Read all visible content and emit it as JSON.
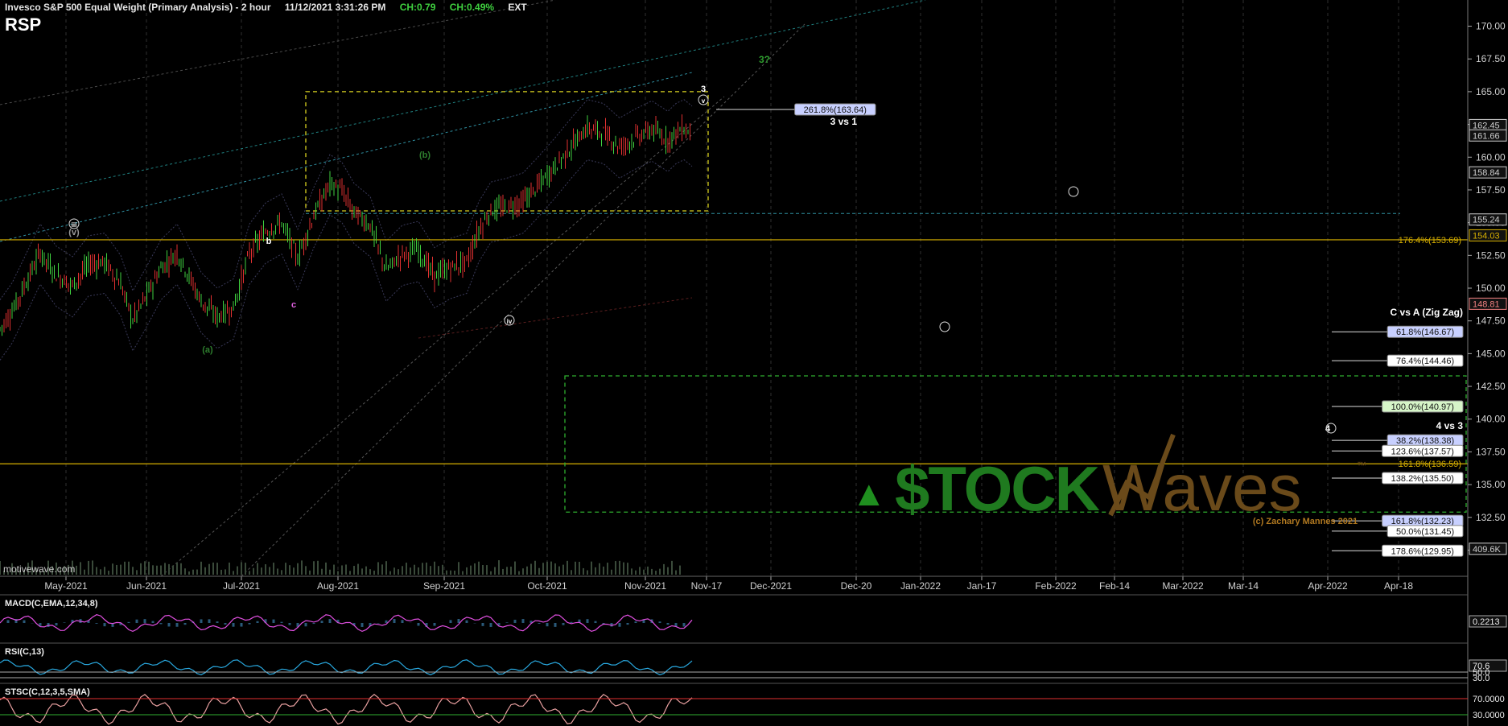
{
  "header": {
    "title": "Invesco S&P 500 Equal Weight (Primary Analysis) - 2 hour",
    "timestamp": "11/12/2021 3:31:26 PM",
    "change": "CH:0.79",
    "change_pct": "CH:0.49%",
    "session": "EXT",
    "symbol": "RSP",
    "brand": "motivewave.com"
  },
  "colors": {
    "bg": "#000000",
    "up": "#3fd13f",
    "down": "#e03030",
    "fib": "#d8b000",
    "axis": "#cfcfcf",
    "macd": "#e04fe0",
    "rsi": "#29a9e0",
    "stoch": "#e8a0a0"
  },
  "chart_data": {
    "type": "line",
    "title": "Invesco S&P 500 Equal Weight (Primary Analysis) - 2 hour",
    "ylim": [
      128.0,
      172.0
    ],
    "y_ticks": [
      "170.00",
      "167.50",
      "165.00",
      "162.50",
      "160.00",
      "157.50",
      "155.00",
      "152.50",
      "150.00",
      "147.50",
      "145.00",
      "142.50",
      "140.00",
      "137.50",
      "135.00",
      "132.50",
      "130.00"
    ],
    "x_ticks": [
      "May-2021",
      "Jun-2021",
      "Jul-2021",
      "Aug-2021",
      "Sep-2021",
      "Oct-2021",
      "Nov-2021",
      "Nov-17",
      "Dec-2021",
      "Dec-20",
      "Jan-2022",
      "Jan-17",
      "Feb-2022",
      "Feb-14",
      "Mar-2022",
      "Mar-14",
      "Apr-2022",
      "Apr-18"
    ],
    "series": [
      {
        "x": [
          0,
          3,
          6,
          10,
          14,
          18,
          22,
          26,
          30,
          33,
          36,
          40,
          44,
          47,
          50,
          54,
          58,
          62,
          66,
          70,
          74,
          78,
          82,
          85,
          88,
          92,
          96,
          100,
          104,
          108,
          112,
          116,
          119,
          122,
          126,
          130,
          134,
          138,
          142,
          146,
          150,
          154,
          158,
          162,
          164,
          166,
          168,
          170,
          172
        ],
        "y": [
          146.9,
          148.2,
          150.1,
          152.7,
          151.0,
          150.2,
          151.8,
          152.0,
          150.3,
          147.6,
          149.2,
          151.5,
          152.7,
          150.9,
          149.0,
          147.8,
          148.5,
          152.7,
          154.3,
          155.0,
          152.3,
          155.5,
          158.0,
          157.4,
          155.8,
          154.8,
          151.4,
          152.6,
          152.9,
          150.9,
          151.6,
          152.0,
          154.4,
          155.9,
          156.2,
          156.6,
          157.9,
          159.3,
          160.8,
          162.2,
          161.9,
          160.8,
          161.5,
          162.1,
          161.7,
          161.3,
          161.9,
          162.2,
          161.7
        ]
      }
    ],
    "price_labels": [
      {
        "value": 162.45,
        "text": "162.45",
        "color": "#cfcfcf"
      },
      {
        "value": 161.66,
        "text": "161.66",
        "color": "#cfcfcf"
      },
      {
        "value": 158.84,
        "text": "158.84",
        "color": "#cfcfcf"
      },
      {
        "value": 155.24,
        "text": "155.24",
        "color": "#cfcfcf"
      },
      {
        "value": 154.03,
        "text": "154.03",
        "color": "#d8b000"
      },
      {
        "value": 148.81,
        "text": "148.81",
        "color": "#f08080"
      },
      {
        "value": 130.1,
        "text": "409.6K",
        "color": "#cfcfcf"
      }
    ],
    "fib_lines": [
      {
        "value": 153.69,
        "label": "176.4%(153.69)"
      },
      {
        "value": 136.59,
        "label": "161.8%(136.59)"
      }
    ],
    "fib_boxes": [
      {
        "value": 163.64,
        "label": "261.8%(163.64)",
        "fill": "#c8d0ff"
      },
      {
        "value": 146.67,
        "label": "61.8%(146.67)",
        "fill": "#c8d0ff"
      },
      {
        "value": 144.46,
        "label": "76.4%(144.46)",
        "fill": "#ffffff"
      },
      {
        "value": 140.97,
        "label": "100.0%(140.97)",
        "fill": "#d6f5c8"
      },
      {
        "value": 138.38,
        "label": "38.2%(138.38)",
        "fill": "#c8d0ff"
      },
      {
        "value": 137.57,
        "label": "123.6%(137.57)",
        "fill": "#ffffff"
      },
      {
        "value": 135.5,
        "label": "138.2%(135.50)",
        "fill": "#ffffff"
      },
      {
        "value": 132.23,
        "label": "161.8%(132.23)",
        "fill": "#c8d0ff"
      },
      {
        "value": 131.45,
        "label": "50.0%(131.45)",
        "fill": "#ffffff"
      },
      {
        "value": 129.95,
        "label": "178.6%(129.95)",
        "fill": "#ffffff"
      }
    ],
    "annotations": [
      "3 vs 1",
      "C vs A (Zig Zag)",
      "4 vs 3",
      "3?",
      "(c) Zachary Mannes 2021"
    ],
    "wave_labels": [
      "3",
      "v",
      "iii",
      "(v)",
      "b",
      "(b)",
      "iv",
      "(a)",
      "c",
      "4"
    ]
  },
  "logo": {
    "prefix": "▲",
    "stock": "$TOCK",
    "waves": "Waves",
    "tm": "™"
  },
  "indicators": [
    {
      "name": "MACD(C,EMA,12,34,8)",
      "value": "0.2213"
    },
    {
      "name": "RSI(C,13)",
      "value": "70.6",
      "levels": [
        "50.0",
        "30.0"
      ]
    },
    {
      "name": "STSC(C,12,3,5,SMA)",
      "levels": [
        "70.0000",
        "30.0000"
      ]
    }
  ]
}
